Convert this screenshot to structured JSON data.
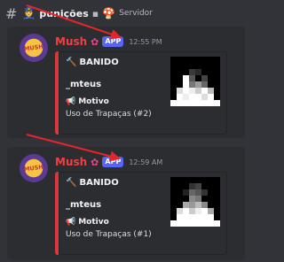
{
  "header": {
    "channel_title": "punições",
    "server_label": "Servidor",
    "emoji": "👮",
    "folder_icon": "folder-icon",
    "server_emoji": "🍄"
  },
  "messages": [
    {
      "username": "Mush",
      "badge": "APP",
      "timestamp": "12:55 PM",
      "embed": {
        "title": "BANIDO",
        "user": "_mteus",
        "field_name": "Motivo",
        "field_value": "Uso de Trapaças (#2)"
      }
    },
    {
      "username": "Mush",
      "badge": "APP",
      "timestamp": "12:59 AM",
      "embed": {
        "title": "BANIDO",
        "user": "_mteus",
        "field_name": "Motivo",
        "field_value": "Uso de Trapaças (#1)"
      }
    }
  ],
  "avatar_text": "MUSH",
  "colors": {
    "username": "#f23f43",
    "badge": "#5865f2",
    "embed_border": "#da373c",
    "arrow": "#e5242b"
  }
}
